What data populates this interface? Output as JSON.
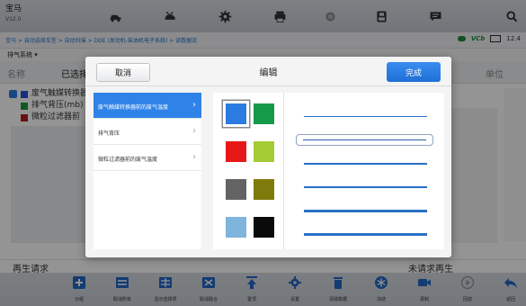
{
  "app": {
    "brand": "宝马",
    "version": "V12.0"
  },
  "topbar": {
    "icons": [
      "car-home-icon",
      "car-tools-icon",
      "gear-icon",
      "printer-icon",
      "color-circle-icon",
      "save-icon",
      "message-icon",
      "search-icon"
    ]
  },
  "breadcrumb": {
    "path": "宝马 > 自动选择车型 > 自动扫描 > DDE (发动机-柴油机电子系统) > 读数据流"
  },
  "vci": {
    "badge": "VCb",
    "battery": "12.4"
  },
  "subheader": {
    "system": "排气系统 ▾"
  },
  "column_headers": {
    "name": "名称",
    "selected": "已选择",
    "unit": "单位"
  },
  "background_items": [
    {
      "label": "废气触媒转换器",
      "color": "#2a4fd8"
    },
    {
      "label": "排气背压(mb)",
      "color": "#1e9a3a"
    },
    {
      "label": "微粒过滤器前",
      "color": "#b02020"
    }
  ],
  "regen": {
    "left": "再生请求",
    "right": "未请求再生"
  },
  "toolbar": {
    "items": [
      {
        "icon": "plus-icon",
        "label": "分组"
      },
      {
        "icon": "clear-all-icon",
        "label": "取消所有"
      },
      {
        "icon": "show-selected-icon",
        "label": "显示选择项"
      },
      {
        "icon": "merge-icon",
        "label": "取消融合"
      },
      {
        "icon": "top-icon",
        "label": "置顶"
      },
      {
        "icon": "settings-icon",
        "label": "设置"
      },
      {
        "icon": "trash-icon",
        "label": "清除数据"
      },
      {
        "icon": "freeze-icon",
        "label": "冻结"
      },
      {
        "icon": "record-icon",
        "label": "录制"
      },
      {
        "icon": "play-icon",
        "label": "回放"
      },
      {
        "icon": "back-icon",
        "label": "返回"
      }
    ]
  },
  "dialog": {
    "title": "编辑",
    "cancel_label": "取消",
    "done_label": "完成",
    "items": [
      {
        "label": "废气触媒转换器前的废气温度",
        "selected": true
      },
      {
        "label": "排气背压",
        "selected": false
      },
      {
        "label": "微粒过滤器前的废气温度",
        "selected": false
      }
    ],
    "colors": [
      {
        "hex": "#2b7be0",
        "selected": true
      },
      {
        "hex": "#149a48",
        "selected": false
      },
      {
        "hex": "#e81818",
        "selected": false
      },
      {
        "hex": "#a4cc35",
        "selected": false
      },
      {
        "hex": "#636363",
        "selected": false
      },
      {
        "hex": "#7e7b0c",
        "selected": false
      },
      {
        "hex": "#7fb4dc",
        "selected": false
      },
      {
        "hex": "#0a0a0a",
        "selected": false
      }
    ],
    "line_styles": [
      {
        "weight": "thin",
        "selected": false
      },
      {
        "weight": "thin",
        "selected": true
      },
      {
        "weight": "medium",
        "selected": false
      },
      {
        "weight": "medium",
        "selected": false
      },
      {
        "weight": "thick",
        "selected": false
      },
      {
        "weight": "thick",
        "selected": false
      }
    ]
  }
}
